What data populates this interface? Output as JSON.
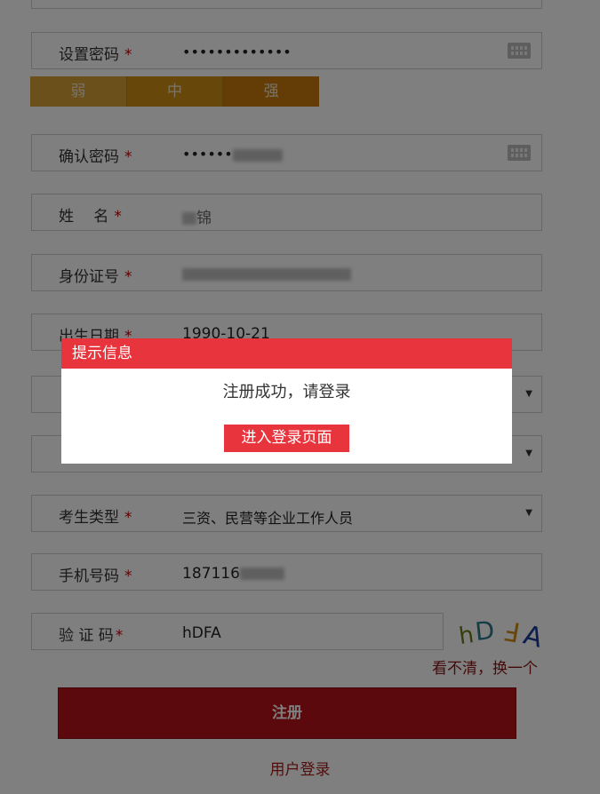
{
  "form": {
    "set_password": {
      "label": "设置密码",
      "required": "*",
      "value": "•••••••••••••"
    },
    "strength": [
      "弱",
      "中",
      "强"
    ],
    "confirm_password": {
      "label": "确认密码",
      "required": "*",
      "value": "••••••"
    },
    "name": {
      "label": "姓　 名",
      "required": "*",
      "value": "锦"
    },
    "id_number": {
      "label": "身份证号",
      "required": "*"
    },
    "birth_date": {
      "label": "出生日期",
      "required": "*",
      "value": "1990-10-21"
    },
    "examinee_type": {
      "label": "考生类型",
      "required": "*",
      "value": "三资、民营等企业工作人员"
    },
    "phone": {
      "label": "手机号码",
      "required": "*",
      "value": "187116"
    },
    "captcha": {
      "label": "验 证 码",
      "required": "*",
      "value": "hDFA",
      "image_text": "hDFA",
      "refresh_label": "看不清，换一个"
    },
    "submit_label": "注册",
    "login_link": "用户登录",
    "select_arrow": "▼"
  },
  "modal": {
    "title": "提示信息",
    "message": "注册成功，请登录",
    "button_label": "进入登录页面"
  },
  "colors": {
    "modal_header": "#e8353d",
    "submit_button": "#b71218",
    "strength_weak": "#d6a037",
    "strength_medium": "#d18f14",
    "strength_strong": "#c77a0a"
  }
}
